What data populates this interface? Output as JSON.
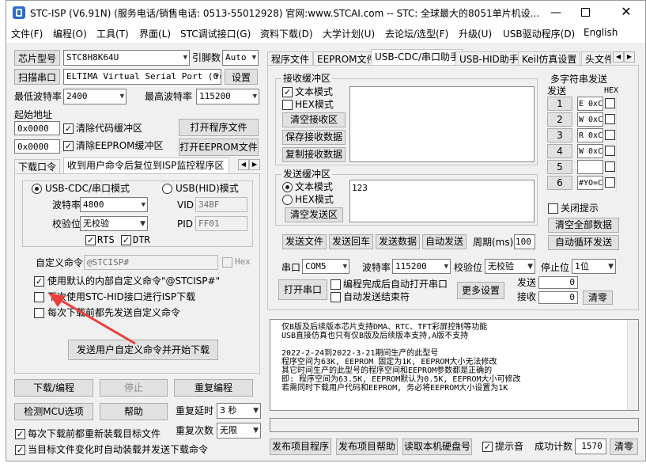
{
  "title": "STC-ISP (V6.91N) (服务电话/销售电话: 0513-55012928) 官网:www.STCAI.com  -- STC: 全球最大的8051单片机设...",
  "menu": [
    "文件(F)",
    "编程(O)",
    "工具(T)",
    "界面(L)",
    "STC调试接口(G)",
    "资料下载(D)",
    "大学计划(U)",
    "去论坛/选型(F)",
    "升级(U)",
    "USB驱动程序(D)",
    "English"
  ],
  "left": {
    "chip_label": "芯片型号",
    "chip_value": "STC8H8K64U",
    "pin_label": "引脚数",
    "pin_value": "Auto",
    "scan_label": "扫描串口",
    "port_value": "ELTIMA Virtual Serial Port (C(",
    "settings_label": "设置",
    "min_baud_label": "最低波特率",
    "min_baud": "2400",
    "max_baud_label": "最高波特率",
    "max_baud": "115200",
    "start_addr_label": "起始地址",
    "addr1": "0x0000",
    "clear_code": "清除代码缓冲区",
    "open_prog": "打开程序文件",
    "addr2": "0x0000",
    "clear_eeprom": "清除EEPROM缓冲区",
    "open_eeprom": "打开EEPROM文件",
    "tabs": [
      "下载口令",
      "收到用户命令后复位到ISP监控程序区"
    ],
    "usb_cdc": "USB-CDC/串口模式",
    "usb_hid": "USB(HID)模式",
    "baud_label": "波特率",
    "baud_value": "4800",
    "vid_label": "VID",
    "vid_value": "34BF",
    "parity_label": "校验位",
    "parity_value": "无校验",
    "pid_label": "PID",
    "pid_value": "FF01",
    "rts": "RTS",
    "dtr": "DTR",
    "custom_cmd_label": "自定义命令",
    "custom_cmd_value": "@STCISP#",
    "hex_label": "Hex",
    "use_default": "使用默认的内部自定义命令\"@STCISP#\"",
    "next_hid": "下次使用STC-HID接口进行ISP下载",
    "each_send": "每次下载前都先发送自定义命令",
    "send_start": "发送用户自定义命令并开始下载",
    "download": "下载/编程",
    "stop": "停止",
    "redownload": "重复编程",
    "check_mcu": "检测MCU选项",
    "help": "帮助",
    "repeat_delay_label": "重复延时",
    "repeat_delay": "3 秒",
    "repeat_count_label": "重复次数",
    "repeat_count": "无限",
    "reload_before": "每次下载前都重新装载目标文件",
    "auto_reload": "当目标文件变化时自动装载并发送下载命令"
  },
  "right": {
    "tabs": [
      "程序文件",
      "EEPROM文件",
      "USB-CDC/串口助手",
      "USB-HID助手",
      "Keil仿真设置",
      "头文件"
    ],
    "recv_group": "接收缓冲区",
    "text_mode": "文本模式",
    "hex_mode": "HEX模式",
    "clear_recv": "清空接收区",
    "save_recv": "保存接收数据",
    "copy_recv": "复制接收数据",
    "send_group": "发送缓冲区",
    "send_text": "123",
    "clear_send": "清空发送区",
    "send_file": "发送文件",
    "send_return": "发送回车",
    "send_data": "发送数据",
    "auto_send": "自动发送",
    "period_label": "周期(ms)",
    "period_value": "100",
    "multi_title": "多字符串发送",
    "send_col": "发送",
    "hex_col": "HEX",
    "multi_rows": [
      {
        "n": "1",
        "v": "E 0xC"
      },
      {
        "n": "2",
        "v": "W 0xC"
      },
      {
        "n": "3",
        "v": "R 0xC"
      },
      {
        "n": "4",
        "v": "W 0xC"
      },
      {
        "n": "5",
        "v": ""
      },
      {
        "n": "6",
        "v": "#YO=C"
      }
    ],
    "close_tip": "关闭提示",
    "clear_all": "清空全部数据",
    "auto_loop": "自动循环发送",
    "port_label": "串口",
    "port_value": "COM5",
    "baud_label": "波特率",
    "baud_value": "115200",
    "parity_label": "校验位",
    "parity_value": "无校验",
    "stop_label": "停止位",
    "stop_value": "1位",
    "open_port": "打开串口",
    "auto_open": "编程完成后自动打开串口",
    "auto_end": "自动发送结束符",
    "more": "更多设置",
    "sent_label": "发送",
    "sent_value": "0",
    "recv_label": "接收",
    "recv_value": "0",
    "clear": "清零",
    "log": [
      "仅B版及后续版本芯片支持DMA、RTC、TFT彩屏控制等功能",
      "USB直接仿真也只有仅B版及后续版本支持,A版不支持",
      "",
      "2022-2-24到2022-3-21期间生产的此型号",
      "程序空间为63K, EEPROM 固定为1K, EEPROM大小无法修改",
      "其它时间生产的此型号的程序空间和EEPROM参数都是正确的",
      "即: 程序空间为63.5K, EEPROM默认为0.5K, EEPROM大小可修改",
      "若需同时下载用户代码和EEPROM, 务必将EEPROM大小设置为1K"
    ],
    "publish": "发布项目程序",
    "publish_help": "发布项目帮助",
    "read_disk": "读取本机硬盘号",
    "tip_sound": "提示音",
    "success_label": "成功计数",
    "success_value": "1570",
    "clear2": "清零"
  },
  "colors": {
    "title_icon": "#2a6fc9",
    "arrow": "#e8413c"
  }
}
